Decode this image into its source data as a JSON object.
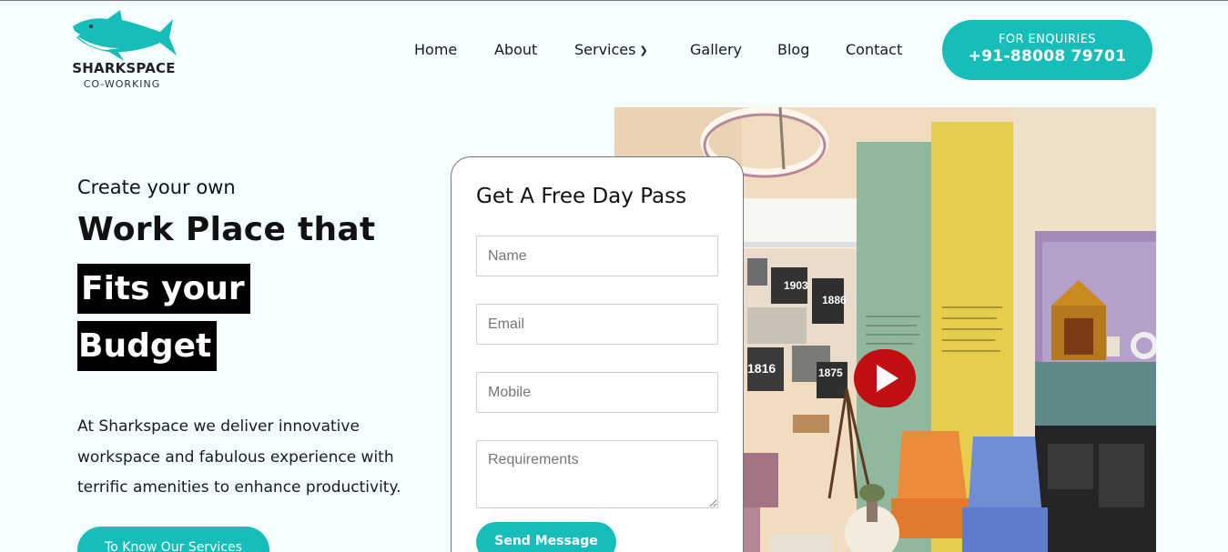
{
  "brand": {
    "name": "SHARKSPACE",
    "tagline": "CO-WORKING",
    "color": "#16bdb9"
  },
  "nav": {
    "items": [
      {
        "label": "Home"
      },
      {
        "label": "About"
      },
      {
        "label": "Services",
        "icon": "chevron-down-icon"
      },
      {
        "label": "Gallery"
      },
      {
        "label": "Blog"
      },
      {
        "label": "Contact"
      }
    ]
  },
  "enquiry": {
    "label": "FOR ENQUIRIES",
    "phone": "+91-88008 79701"
  },
  "hero": {
    "kicker": "Create your own",
    "title": "Work Place that",
    "highlight_1": "Fits your",
    "highlight_2": "Budget",
    "description": "At Sharkspace we deliver innovative workspace and fabulous experience with terrific amenities to enhance productivity.",
    "cta": "To Know Our Services"
  },
  "form": {
    "title": "Get A Free Day Pass",
    "name_placeholder": "Name",
    "email_placeholder": "Email",
    "mobile_placeholder": "Mobile",
    "requirements_placeholder": "Requirements",
    "submit": "Send Message"
  },
  "video": {
    "icon": "play-icon",
    "color": "#c20e12"
  },
  "photo_wall": {
    "years": [
      "1903",
      "1886",
      "1816",
      "1875"
    ]
  }
}
